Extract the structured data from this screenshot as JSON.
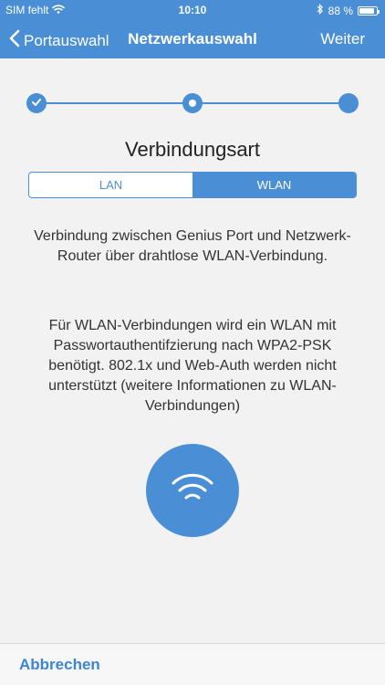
{
  "status_bar": {
    "carrier": "SIM fehlt",
    "time": "10:10",
    "battery_percent_label": "88 %",
    "battery_level": 0.88,
    "icons": [
      "wifi-icon",
      "bluetooth-icon",
      "battery-icon"
    ]
  },
  "nav": {
    "back_label": "Portauswahl",
    "title": "Netzwerkauswahl",
    "next_label": "Weiter"
  },
  "stepper": {
    "steps": 3,
    "current_step": 2,
    "completed": [
      1
    ],
    "icons": [
      "checkmark-icon"
    ]
  },
  "section": {
    "title": "Verbindungsart"
  },
  "segments": {
    "options": [
      "LAN",
      "WLAN"
    ],
    "selected": "WLAN"
  },
  "description": {
    "p1": "Verbindung zwischen Genius Port und Netzwerk-Router über drahtlose WLAN-Verbindung.",
    "p2": "Für WLAN-Verbindungen wird ein WLAN mit Passwortauthentifzierung nach WPA2-PSK benötigt. 802.1x und Web-Auth werden nicht unterstützt (weitere Informationen zu WLAN-Verbindungen)"
  },
  "footer": {
    "cancel_label": "Abbrechen"
  },
  "colors": {
    "accent": "#4a8fd6",
    "background": "#f2f2f2"
  }
}
